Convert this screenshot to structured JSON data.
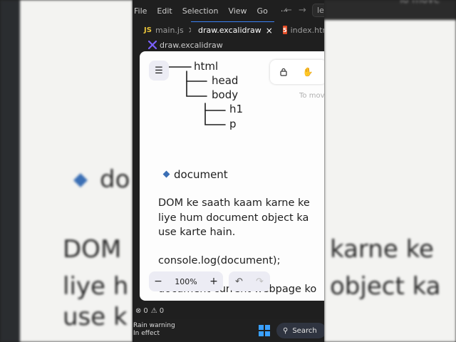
{
  "background": {
    "left_bullet": "do",
    "left_lines": [
      "DOM",
      "liye h",
      "use k"
    ],
    "right_lines": [
      "karne ke",
      "object ka"
    ],
    "right_top_hint": "To move"
  },
  "menubar": {
    "items": [
      "File",
      "Edit",
      "Selection",
      "View",
      "Go"
    ],
    "more": "···",
    "back_icon": "arrow-left-icon",
    "forward_icon": "arrow-right-icon",
    "command_center_text": "le"
  },
  "tabs": [
    {
      "label": "main.js",
      "icon": "js-icon",
      "badge": "JS",
      "close": "×",
      "active": false
    },
    {
      "label": "draw.excalidraw",
      "icon": "excalidraw-icon",
      "close": "×",
      "active": true
    },
    {
      "label": "index.htm",
      "icon": "html5-icon",
      "badge": "5",
      "active": false
    }
  ],
  "breadcrumb": {
    "file": "draw.excalidraw"
  },
  "canvas": {
    "tree": {
      "root": "html",
      "children_1": [
        "head",
        "body"
      ],
      "children_2": [
        "h1",
        "p"
      ]
    },
    "bullet_text": "document",
    "paragraph_lines": [
      "DOM ke saath kaam karne ke",
      "liye hum document object ka",
      "use karte hain."
    ],
    "code_line": "console.log(document);",
    "cut_line": "document current webpage ko",
    "hint_text": "To move",
    "zoom": {
      "minus": "−",
      "value": "100%",
      "plus": "+"
    },
    "undo_icon": "undo-icon",
    "redo_icon": "redo-icon",
    "menu_icon": "hamburger-icon",
    "lock_icon": "lock-icon",
    "hand_icon": "hand-icon"
  },
  "statusbar": {
    "errors": "0",
    "warnings": "0"
  },
  "taskbar": {
    "weather_title": "Rain warning",
    "weather_sub": "In effect",
    "search_label": "Search"
  },
  "colors": {
    "accent": "#3b82f6",
    "diamond": "#3b6fb5",
    "canvas_bg": "#fdfdfd",
    "editor_bg": "#1f1f1f"
  }
}
